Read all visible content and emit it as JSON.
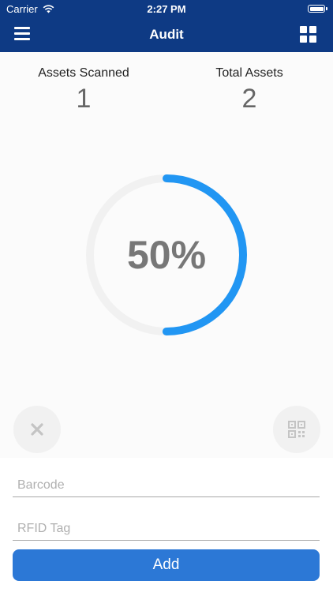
{
  "status_bar": {
    "carrier": "Carrier",
    "time": "2:27 PM"
  },
  "nav": {
    "title": "Audit",
    "menu_icon": "hamburger-menu-icon",
    "grid_icon": "grid-view-icon"
  },
  "stats": {
    "scanned_label": "Assets Scanned",
    "scanned_value": "1",
    "total_label": "Total Assets",
    "total_value": "2"
  },
  "progress": {
    "percent_text": "50%",
    "fraction": 0.5,
    "accent_color": "#2196f3",
    "track_color": "#f1f1f1"
  },
  "actions": {
    "clear_icon": "close-icon",
    "scan_icon": "qr-code-icon"
  },
  "form": {
    "barcode_placeholder": "Barcode",
    "rfid_placeholder": "RFID Tag",
    "add_label": "Add"
  },
  "colors": {
    "header_bg": "#0e3a84",
    "button_bg": "#2c78d6"
  }
}
